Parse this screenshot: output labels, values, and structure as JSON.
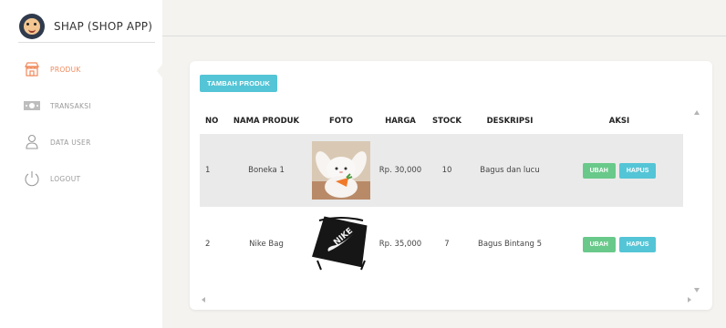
{
  "app": {
    "brand_title": "SHAP (SHOP APP)"
  },
  "sidebar": {
    "items": [
      {
        "label": "PRODUK",
        "icon": "shop-icon",
        "active": true
      },
      {
        "label": "TRANSAKSI",
        "icon": "money-icon",
        "active": false
      },
      {
        "label": "DATA USER",
        "icon": "user-icon",
        "active": false
      },
      {
        "label": "LOGOUT",
        "icon": "power-icon",
        "active": false
      }
    ]
  },
  "main": {
    "add_button_label": "TAMBAH PRODUK",
    "table": {
      "headers": [
        "NO",
        "NAMA PRODUK",
        "FOTO",
        "HARGA",
        "STOCK",
        "DESKRIPSI",
        "AKSI"
      ],
      "rows": [
        {
          "no": "1",
          "name": "Boneka 1",
          "photo": "plush-bunny",
          "price": "Rp. 30,000",
          "stock": "10",
          "desc": "Bagus dan lucu"
        },
        {
          "no": "2",
          "name": "Nike Bag",
          "photo": "nike-drawstring-bag",
          "price": "Rp. 35,000",
          "stock": "7",
          "desc": "Bagus Bintang 5"
        }
      ],
      "action_edit": "UBAH",
      "action_delete": "HAPUS"
    }
  },
  "colors": {
    "accent_orange": "#f08a5d",
    "button_teal": "#54c5d6",
    "button_green": "#69c98a",
    "background": "#f4f3ef"
  }
}
